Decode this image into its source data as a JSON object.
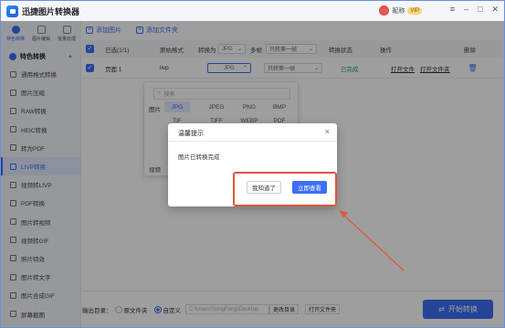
{
  "app": {
    "title": "迅捷图片转换器"
  },
  "user": {
    "name": "昵称",
    "badge": "VIP"
  },
  "top_tabs": [
    {
      "label": "特色转换"
    },
    {
      "label": "图片编辑"
    },
    {
      "label": "批量处理"
    }
  ],
  "sidebar": {
    "section_title": "特色转换",
    "items": [
      {
        "label": "通用格式转换"
      },
      {
        "label": "图片压缩"
      },
      {
        "label": "RAW转换"
      },
      {
        "label": "HEIC转换"
      },
      {
        "label": "转为PDF"
      },
      {
        "label": "LIVP转换"
      },
      {
        "label": "视频转LIVP"
      },
      {
        "label": "PDF转换"
      },
      {
        "label": "图片转视频"
      },
      {
        "label": "视频转GIF"
      },
      {
        "label": "照片特效"
      },
      {
        "label": "图片转文字"
      },
      {
        "label": "图片合成GIF"
      },
      {
        "label": "屏幕截图"
      }
    ]
  },
  "toolbar": {
    "add_image": "添加图片",
    "add_folder": "添加文件夹"
  },
  "table": {
    "headers": {
      "selected": "已选(1/1)",
      "original_format": "原始格式",
      "convert_to": "转换为",
      "convert_to_value": "JPG",
      "multi_frame": "多帧",
      "multi_frame_value": "只转第一帧",
      "status": "转换状态",
      "action": "操作",
      "delete": "删除"
    },
    "rows": [
      {
        "name": "页面 1",
        "format": "livp",
        "target": "JPG",
        "frame": "只转第一帧",
        "status": "已完成",
        "open_file": "打开文件",
        "open_folder": "打开文件夹"
      }
    ]
  },
  "dropdown": {
    "search_placeholder": "搜索",
    "group_image": "图片",
    "formats": [
      "JPG",
      "JPEG",
      "PNG",
      "BMP",
      "TIF",
      "TIFF",
      "WEBP",
      "PDF"
    ],
    "group_video": "视频"
  },
  "dialog": {
    "title": "温馨提示",
    "message": "图片已转换完成",
    "secondary_button": "我知道了",
    "primary_button": "立即查看"
  },
  "bottom": {
    "output_label": "输出目录：",
    "option_original": "原文件夹",
    "option_custom": "自定义",
    "path_value": "C:\\Users\\SongFeng\\Desktop",
    "change_dir": "更改目录",
    "open_folder": "打开文件夹",
    "start_button": "开始转换"
  },
  "colors": {
    "accent": "#3d6ef5",
    "success": "#1aa85a",
    "annotation": "#e4543a"
  }
}
